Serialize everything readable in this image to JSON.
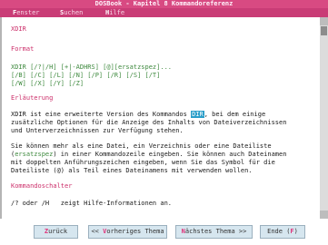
{
  "window": {
    "title": "DOSBook - Kapitel 8 Kommandoreferenz"
  },
  "menu": [
    {
      "key": "F",
      "rest": "enster"
    },
    {
      "key": "S",
      "rest": "uchen"
    },
    {
      "key": "H",
      "rest": "ilfe"
    }
  ],
  "content": {
    "heading": "XDIR",
    "format_label": "Format",
    "syntax1": "XDIR [/?|/H] [+|-ADHRS] [@][ersatzspez]...",
    "syntax2": "[/B] [/C] [/L] [/N] [/P] [/R] [/S] [/T]",
    "syntax3": "[/W] [/X] [/Y] [/Z]",
    "expl_label": "Erläuterung",
    "p1a": "XDIR ist eine erweiterte Version des Kommandos ",
    "p1_link": "DIR",
    "p1b": ", bei dem einige",
    "p1c": "zusätzliche Optionen für die Anzeige des Inhalts von Dateiverzeichnissen",
    "p1d": "und Unterverzeichnissen zur Verfügung stehen.",
    "p2a": "Sie können mehr als eine Datei, ein Verzeichnis oder eine Dateiliste",
    "p2b_pre": "(",
    "p2b_link": "ersatzspez",
    "p2b_post": ") in einer Kommandozeile eingeben. Sie können auch Dateinamen",
    "p2c": "mit doppelten Anführungszeichen eingeben, wenn Sie das Symbol für die",
    "p2d": "Dateiliste (@) als Teil eines Dateinamens mit verwenden wollen.",
    "switches_label": "Kommandoschalter",
    "switch1": "/? oder /H   zeigt Hilfe-Informationen an."
  },
  "buttons": {
    "back": {
      "key": "Z",
      "rest": "urück"
    },
    "prev": {
      "pre": "<< ",
      "key": "V",
      "rest": "orheriges Thema"
    },
    "next": {
      "key": "N",
      "rest": "ächstes Thema >>"
    },
    "end": {
      "pre": "Ende (",
      "key": "F",
      "post": ")"
    }
  }
}
